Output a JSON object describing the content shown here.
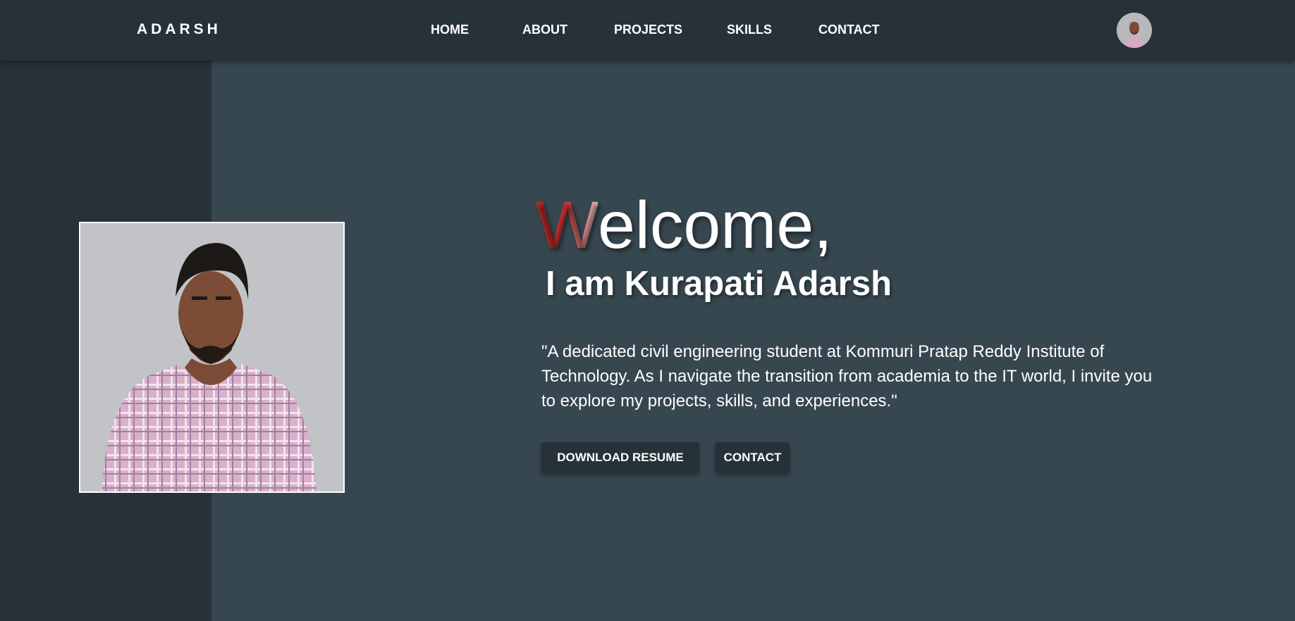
{
  "navbar": {
    "brand": "ADARSH",
    "links": [
      "HOME",
      "ABOUT",
      "PROJECTS",
      "SKILLS",
      "CONTACT"
    ]
  },
  "hero": {
    "welcome_first": "W",
    "welcome_rest": "elcome,",
    "name_line": "I am Kurapati Adarsh",
    "intro": "\"A dedicated civil engineering student at Kommuri Pratap Reddy Institute of Technology. As I navigate the transition from academia to the IT world, I invite you to explore my projects, skills, and experiences.\"",
    "download_button": "DOWNLOAD RESUME",
    "contact_button": "CONTACT"
  },
  "colors": {
    "navbar_bg": "#263238",
    "page_bg": "#37474f",
    "accent_red": "#d32f2f",
    "text": "#ffffff"
  }
}
